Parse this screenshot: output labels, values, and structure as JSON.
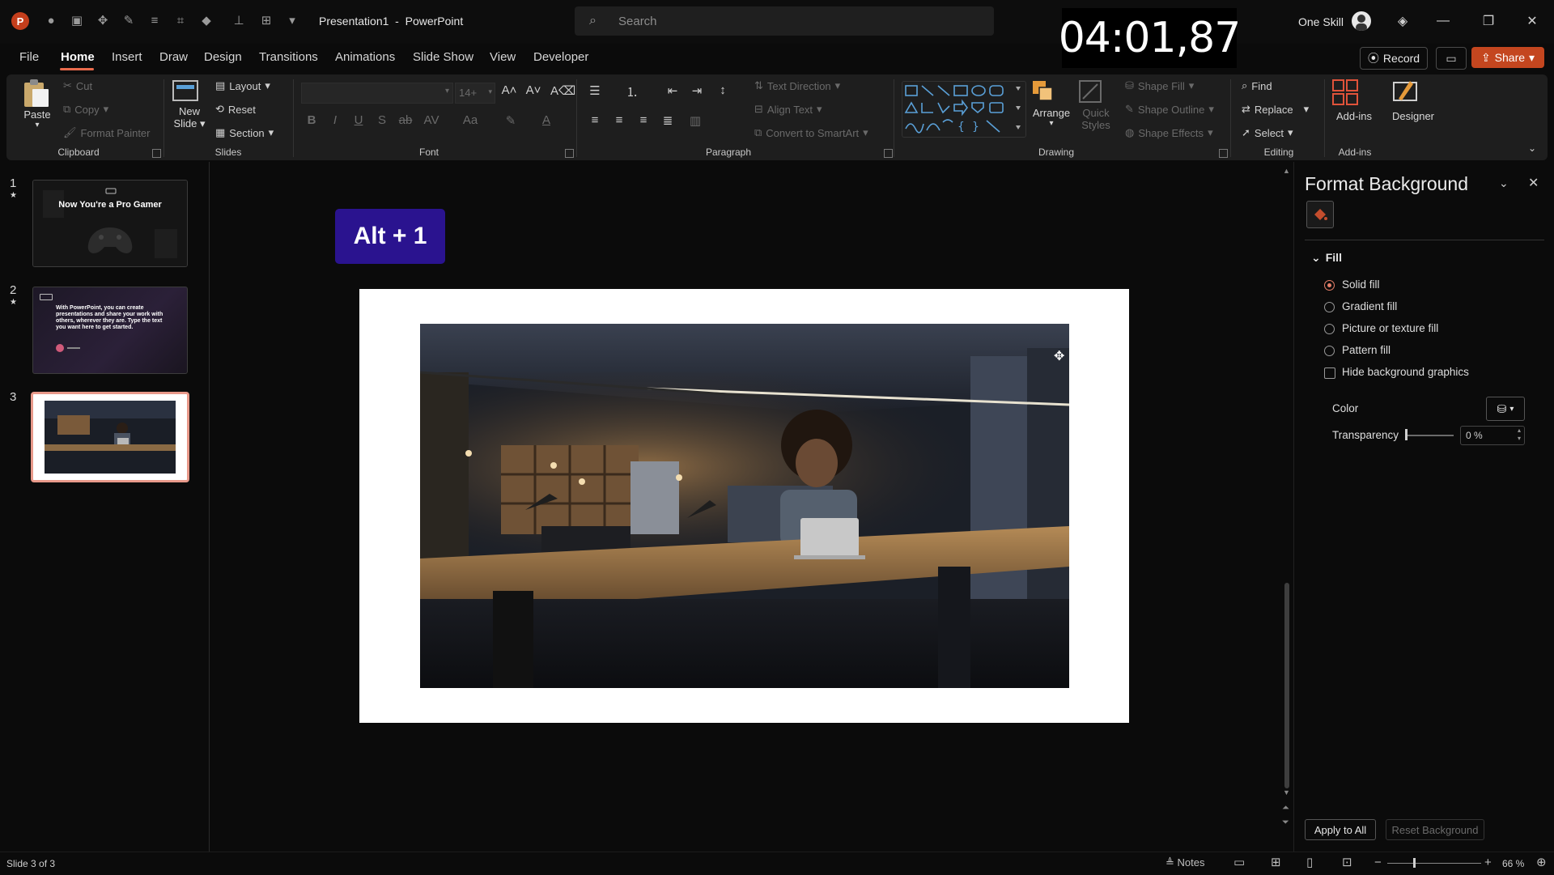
{
  "app": {
    "document_title": "Presentation1  -  PowerPoint",
    "search_placeholder": "Search",
    "timer": "04:01,87",
    "account_name": "One Skill"
  },
  "menu": {
    "tabs": [
      "File",
      "Home",
      "Insert",
      "Draw",
      "Design",
      "Transitions",
      "Animations",
      "Slide Show",
      "View",
      "Developer"
    ],
    "active_tab": "Home",
    "record_label": "Record",
    "share_label": "Share"
  },
  "ribbon": {
    "clipboard": {
      "label": "Clipboard",
      "paste": "Paste",
      "cut": "Cut",
      "copy": "Copy",
      "format_painter": "Format Painter"
    },
    "slides": {
      "label": "Slides",
      "new_slide_line1": "New",
      "new_slide_line2": "Slide",
      "layout": "Layout",
      "reset": "Reset",
      "section": "Section"
    },
    "font": {
      "label": "Font",
      "size": "14+"
    },
    "paragraph": {
      "label": "Paragraph",
      "text_direction": "Text Direction",
      "align_text": "Align Text",
      "convert_smartart": "Convert to SmartArt"
    },
    "drawing": {
      "label": "Drawing",
      "arrange": "Arrange",
      "quick_styles_line1": "Quick",
      "quick_styles_line2": "Styles",
      "shape_fill": "Shape Fill",
      "shape_outline": "Shape Outline",
      "shape_effects": "Shape Effects"
    },
    "editing": {
      "label": "Editing",
      "find": "Find",
      "replace": "Replace",
      "select": "Select"
    },
    "addins": {
      "label": "Add-ins",
      "addins_btn": "Add-ins",
      "designer": "Designer"
    }
  },
  "slides_panel": {
    "items": [
      {
        "number": "1",
        "star": "★",
        "title": "Now You're a Pro Gamer"
      },
      {
        "number": "2",
        "star": "★",
        "body": "With PowerPoint, you can create presentations and share your work with others, wherever they are. Type the text you want here to get started."
      },
      {
        "number": "3",
        "star": ""
      }
    ]
  },
  "canvas": {
    "shortcut_badge": "Alt + 1"
  },
  "format_pane": {
    "title": "Format Background",
    "section": "Fill",
    "options": [
      "Solid fill",
      "Gradient fill",
      "Picture or texture fill",
      "Pattern fill"
    ],
    "selected_option": "Solid fill",
    "hide_bg_graphics": "Hide background graphics",
    "hide_bg_checked": false,
    "color_label": "Color",
    "transparency_label": "Transparency",
    "transparency_value": "0 %",
    "apply_all": "Apply to All",
    "reset_bg": "Reset Background"
  },
  "status": {
    "slide_info": "Slide 3 of 3",
    "notes": "Notes",
    "zoom": "66 %"
  },
  "colors": {
    "accent": "#e86a4c",
    "share": "#c4461f",
    "badge": "#2a138f",
    "selected_thumb": "#e8998a"
  }
}
